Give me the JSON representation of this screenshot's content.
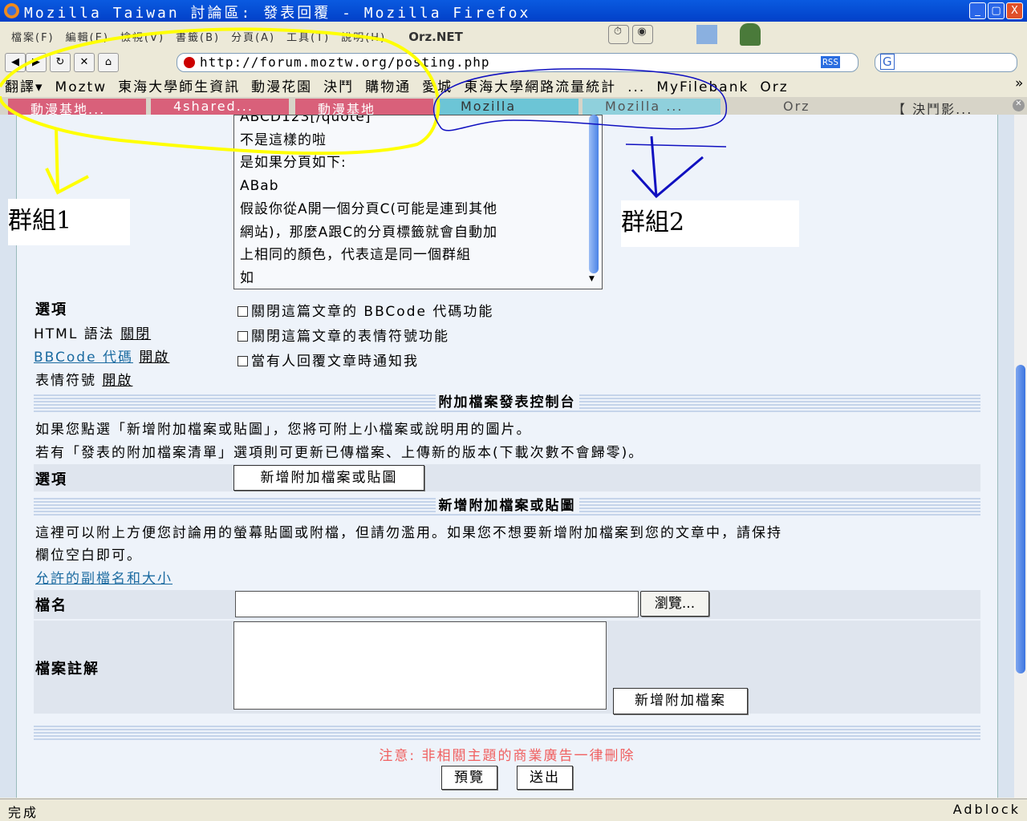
{
  "window": {
    "title": "Mozilla Taiwan 討論區: 發表回覆 - Mozilla Firefox",
    "min": "_",
    "max": "▢",
    "close": "X"
  },
  "menu": [
    "檔案(F)",
    "編輯(E)",
    "檢視(V)",
    "書籤(B)",
    "分頁(A)",
    "工具(T)",
    "說明(H)"
  ],
  "toolbar": {
    "brand": "Orz.NET",
    "url": "http://forum.moztw.org/posting.php",
    "rss": "RSS",
    "search_logo": "G"
  },
  "bookmarks": [
    "翻譯▾",
    "Moztw",
    "東海大學師生資訊",
    "動漫花園",
    "決鬥",
    "購物通",
    "愛城",
    "東海大學網路流量統計",
    "...",
    "MyFilebank",
    "Orz",
    "»"
  ],
  "tabs": [
    {
      "label": "動漫基地...",
      "color": "#d9607a"
    },
    {
      "label": "4shared...",
      "color": "#d9607a"
    },
    {
      "label": "動漫基地",
      "color": "#d9607a"
    },
    {
      "label": "Mozilla",
      "color": "#6cc5d6"
    },
    {
      "label": "Mozilla ...",
      "color": "#8fd0dc"
    },
    {
      "label": "Orz",
      "color": "#d7d4c8"
    },
    {
      "label": "【 決鬥影...",
      "color": "#d7d4c8"
    }
  ],
  "editor": {
    "lines": [
      "ABCD123[/quote]",
      "不是這樣的啦",
      "是如果分頁如下:",
      "ABab",
      "假設你從A開一個分頁C(可能是連到其他",
      "網站)，那麼A跟C的分頁標籤就會自動加",
      "上相同的顏色，代表這是同一個群組",
      "如"
    ]
  },
  "options": {
    "label": "選項",
    "html": "HTML 語法",
    "html_state": "關閉",
    "bbcode": "BBCode 代碼",
    "bbcode_state": "開啟",
    "smilies": "表情符號",
    "smilies_state": "開啟",
    "checks": [
      "關閉這篇文章的 BBCode 代碼功能",
      "關閉這篇文章的表情符號功能",
      "當有人回覆文章時通知我"
    ]
  },
  "attach_panel": {
    "title": "附加檔案發表控制台",
    "desc1": "如果您點選「新增附加檔案或貼圖」，您將可附上小檔案或說明用的圖片。",
    "desc2": "若有「發表的附加檔案清單」選項則可更新已傳檔案、上傳新的版本(下載次數不會歸零)。",
    "option_label": "選項",
    "add_button": "新增附加檔案或貼圖"
  },
  "add_attach": {
    "title": "新增附加檔案或貼圖",
    "desc1": "這裡可以附上方便您討論用的螢幕貼圖或附檔，但請勿濫用。如果您不想要新增附加檔案到您的文章中，請保持",
    "desc2": "欄位空白即可。",
    "allowed_link": "允許的副檔名和大小",
    "filename_label": "檔名",
    "filename_value": "",
    "browse": "瀏覽...",
    "comment_label": "檔案註解",
    "comment_value": "",
    "add_file_button": "新增附加檔案"
  },
  "footer": {
    "notice": "注意: 非相關主題的商業廣告一律刪除",
    "preview": "預覽",
    "submit": "送出",
    "notice_color": "#f06060"
  },
  "status": {
    "text": "完成",
    "adblock": "Adblock"
  },
  "annotations": {
    "group1": "群組1",
    "group2": "群組2"
  }
}
